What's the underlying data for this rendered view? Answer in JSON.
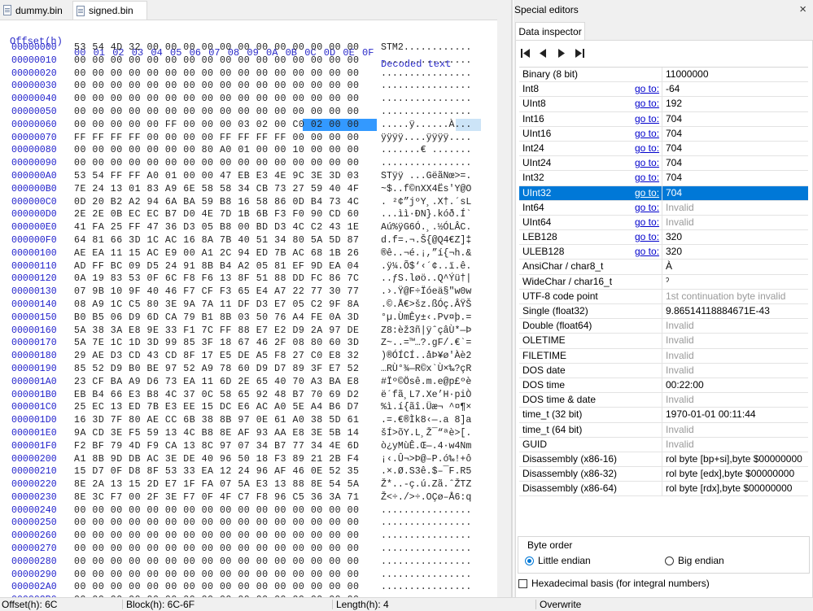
{
  "tabs": [
    {
      "label": "dummy.bin",
      "active": false
    },
    {
      "label": "signed.bin",
      "active": true
    }
  ],
  "hex_header": {
    "offset_label": "Offset(h)",
    "columns": [
      "00",
      "01",
      "02",
      "03",
      "04",
      "05",
      "06",
      "07",
      "08",
      "09",
      "0A",
      "0B",
      "0C",
      "0D",
      "0E",
      "0F"
    ],
    "decoded_label": "Decoded text"
  },
  "hex_rows": [
    {
      "offset": "00000000",
      "bytes": "53 54 4D 32 00 00 00 00 00 00 00 00 00 00 00 00",
      "text": "STM2............"
    },
    {
      "offset": "00000010",
      "bytes": "00 00 00 00 00 00 00 00 00 00 00 00 00 00 00 00",
      "text": "................"
    },
    {
      "offset": "00000020",
      "bytes": "00 00 00 00 00 00 00 00 00 00 00 00 00 00 00 00",
      "text": "................"
    },
    {
      "offset": "00000030",
      "bytes": "00 00 00 00 00 00 00 00 00 00 00 00 00 00 00 00",
      "text": "................"
    },
    {
      "offset": "00000040",
      "bytes": "00 00 00 00 00 00 00 00 00 00 00 00 00 00 00 00",
      "text": "................"
    },
    {
      "offset": "00000050",
      "bytes": "00 00 00 00 00 00 00 00 00 00 00 00 00 00 00 00",
      "text": "................"
    },
    {
      "offset": "00000060",
      "bytes": "00 00 00 00 00 FF 00 00 00 03 02 00 C0 02 00 00",
      "text": ".....ÿ......À..."
    },
    {
      "offset": "00000070",
      "bytes": "FF FF FF FF 00 00 00 00 FF FF FF FF 00 00 00 00",
      "text": "ÿÿÿÿ....ÿÿÿÿ...."
    },
    {
      "offset": "00000080",
      "bytes": "00 00 00 00 00 00 00 80 A0 01 00 00 10 00 00 00",
      "text": ".......€ ......."
    },
    {
      "offset": "00000090",
      "bytes": "00 00 00 00 00 00 00 00 00 00 00 00 00 00 00 00",
      "text": "................"
    },
    {
      "offset": "000000A0",
      "bytes": "53 54 FF FF A0 01 00 00 47 EB E3 4E 9C 3E 3D 03",
      "text": "STÿÿ ...GëãNœ>=."
    },
    {
      "offset": "000000B0",
      "bytes": "7E 24 13 01 83 A9 6E 58 58 34 CB 73 27 59 40 4F",
      "text": "~$..f©nXX4Ës'Y@O"
    },
    {
      "offset": "000000C0",
      "bytes": "0D 20 B2 A2 94 6A BA 59 B8 16 58 86 0D B4 73 4C",
      "text": ". ²¢”jºY¸.X†.´sL"
    },
    {
      "offset": "000000D0",
      "bytes": "2E 2E 0B EC EC B7 D0 4E 7D 1B 6B F3 F0 90 CD 60",
      "text": "...ìì·ÐN}.kóð.Í`"
    },
    {
      "offset": "000000E0",
      "bytes": "41 FA 25 FF 47 36 D3 05 B8 00 BD D3 4C C2 43 1E",
      "text": "Aú%ÿG6Ó.¸.½ÓLÂC."
    },
    {
      "offset": "000000F0",
      "bytes": "64 81 66 3D 1C AC 16 8A 7B 40 51 34 80 5A 5D 87",
      "text": "d.f=.¬.Š{@Q4€Z]‡"
    },
    {
      "offset": "00000100",
      "bytes": "AE EA 11 15 AC E9 00 A1 2C 94 ED 7B AC 68 1B 26",
      "text": "®ê..¬é.¡,”í{¬h.&"
    },
    {
      "offset": "00000110",
      "bytes": "AD FF BC 09 D5 24 91 8B B4 A2 05 81 EF 9D EA 04",
      "text": ".ÿ¼.Õ$‘‹´¢..ï.ê."
    },
    {
      "offset": "00000120",
      "bytes": "0A 19 83 53 0F 6C F8 F6 13 8F 51 88 DD FC 86 7C",
      "text": "..ƒS.løö..Q^Ýü†|"
    },
    {
      "offset": "00000130",
      "bytes": "07 9B 10 9F 40 46 F7 CF F3 65 E4 A7 22 77 30 77",
      "text": ".›.Ÿ@F÷Ïóeä§\"w0w"
    },
    {
      "offset": "00000140",
      "bytes": "08 A9 1C C5 80 3E 9A 7A 11 DF D3 E7 05 C2 9F 8A",
      "text": ".©.Å€>šz.ßÓç.ÂŸŠ"
    },
    {
      "offset": "00000150",
      "bytes": "B0 B5 06 D9 6D CA 79 B1 8B 03 50 76 A4 FE 0A 3D",
      "text": "°µ.ÙmÊy±‹.Pv¤þ.="
    },
    {
      "offset": "00000160",
      "bytes": "5A 38 3A E8 9E 33 F1 7C FF 88 E7 E2 D9 2A 97 DE",
      "text": "Z8:èž3ñ|ÿˆçâÙ*—Þ"
    },
    {
      "offset": "00000170",
      "bytes": "5A 7E 1C 1D 3D 99 85 3F 18 67 46 2F 08 80 60 3D",
      "text": "Z~..=™…?.gF/.€`="
    },
    {
      "offset": "00000180",
      "bytes": "29 AE D3 CD 43 CD 8F 17 E5 DE A5 F8 27 C0 E8 32",
      "text": ")®ÓÍCÍ..åÞ¥ø'Àè2"
    },
    {
      "offset": "00000190",
      "bytes": "85 52 D9 B0 BE 97 52 A9 78 60 D9 D7 89 3F E7 52",
      "text": "…RÙ°¾—R©x`Ù×‰?çR"
    },
    {
      "offset": "000001A0",
      "bytes": "23 CF BA A9 D6 73 EA 11 6D 2E 65 40 70 A3 BA E8",
      "text": "#Ïº©Ösê.m.e@p£ºè"
    },
    {
      "offset": "000001B0",
      "bytes": "EB B4 66 E3 B8 4C 37 0C 58 65 92 48 B7 70 69 D2",
      "text": "ë´fã¸L7.Xe’H·piÒ"
    },
    {
      "offset": "000001C0",
      "bytes": "25 EC 13 ED 7B E3 EE 15 DC E6 AC A0 5E A4 B6 D7",
      "text": "%ì.í{ãî.Üæ¬ ^¤¶×"
    },
    {
      "offset": "000001D0",
      "bytes": "16 3D 7F 80 AE CC 6B 38 8B 97 0E 61 A0 38 5D 61",
      "text": ".=.€®Ìk8‹—.a 8]a"
    },
    {
      "offset": "000001E0",
      "bytes": "9A CD 3E F5 59 13 4C B8 8E AF 93 AA E8 3E 5B 14",
      "text": "šÍ>õY.L¸Ž¯“ªè>[."
    },
    {
      "offset": "000001F0",
      "bytes": "F2 BF 79 4D F9 CA 13 8C 97 07 34 B7 77 34 4E 6D",
      "text": "ò¿yMùÊ.Œ—.4·w4Nm"
    },
    {
      "offset": "00000200",
      "bytes": "A1 8B 9D DB AC 3E DE 40 96 50 18 F3 89 21 2B F4",
      "text": "¡‹.Û¬>Þ@–P.ó‰!+ô"
    },
    {
      "offset": "00000210",
      "bytes": "15 D7 0F D8 8F 53 33 EA 12 24 96 AF 46 0E 52 35",
      "text": ".×.Ø.S3ê.$–¯F.R5"
    },
    {
      "offset": "00000220",
      "bytes": "8E 2A 13 15 2D E7 1F FA 07 5A E3 13 88 8E 54 5A",
      "text": "Ž*..-ç.ú.Zã.ˆŽTZ"
    },
    {
      "offset": "00000230",
      "bytes": "8E 3C F7 00 2F 3E F7 0F 4F C7 F8 96 C5 36 3A 71",
      "text": "Ž<÷./>÷.OÇø–Å6:q"
    },
    {
      "offset": "00000240",
      "bytes": "00 00 00 00 00 00 00 00 00 00 00 00 00 00 00 00",
      "text": "................"
    },
    {
      "offset": "00000250",
      "bytes": "00 00 00 00 00 00 00 00 00 00 00 00 00 00 00 00",
      "text": "................"
    },
    {
      "offset": "00000260",
      "bytes": "00 00 00 00 00 00 00 00 00 00 00 00 00 00 00 00",
      "text": "................"
    },
    {
      "offset": "00000270",
      "bytes": "00 00 00 00 00 00 00 00 00 00 00 00 00 00 00 00",
      "text": "................"
    },
    {
      "offset": "00000280",
      "bytes": "00 00 00 00 00 00 00 00 00 00 00 00 00 00 00 00",
      "text": "................"
    },
    {
      "offset": "00000290",
      "bytes": "00 00 00 00 00 00 00 00 00 00 00 00 00 00 00 00",
      "text": "................"
    },
    {
      "offset": "000002A0",
      "bytes": "00 00 00 00 00 00 00 00 00 00 00 00 00 00 00 00",
      "text": "................"
    },
    {
      "offset": "000002B0",
      "bytes": "00 00 00 00 00 00 00 00 00 00 00 00 00 00 00 00",
      "text": "................"
    }
  ],
  "special_editors": {
    "title": "Special editors",
    "close_glyph": "×",
    "tab_label": "Data inspector",
    "go_to_label": "go to:",
    "rows": [
      {
        "name": "Binary (8 bit)",
        "goto": false,
        "value": "11000000",
        "invalid": false,
        "selected": false
      },
      {
        "name": "Int8",
        "goto": true,
        "value": "-64",
        "invalid": false,
        "selected": false
      },
      {
        "name": "UInt8",
        "goto": true,
        "value": "192",
        "invalid": false,
        "selected": false
      },
      {
        "name": "Int16",
        "goto": true,
        "value": "704",
        "invalid": false,
        "selected": false
      },
      {
        "name": "UInt16",
        "goto": true,
        "value": "704",
        "invalid": false,
        "selected": false
      },
      {
        "name": "Int24",
        "goto": true,
        "value": "704",
        "invalid": false,
        "selected": false
      },
      {
        "name": "UInt24",
        "goto": true,
        "value": "704",
        "invalid": false,
        "selected": false
      },
      {
        "name": "Int32",
        "goto": true,
        "value": "704",
        "invalid": false,
        "selected": false
      },
      {
        "name": "UInt32",
        "goto": true,
        "value": "704",
        "invalid": false,
        "selected": true
      },
      {
        "name": "Int64",
        "goto": true,
        "value": "Invalid",
        "invalid": true,
        "selected": false
      },
      {
        "name": "UInt64",
        "goto": true,
        "value": "Invalid",
        "invalid": true,
        "selected": false
      },
      {
        "name": "LEB128",
        "goto": true,
        "value": "320",
        "invalid": false,
        "selected": false
      },
      {
        "name": "ULEB128",
        "goto": true,
        "value": "320",
        "invalid": false,
        "selected": false
      },
      {
        "name": "AnsiChar / char8_t",
        "goto": false,
        "value": "À",
        "invalid": false,
        "selected": false
      },
      {
        "name": "WideChar / char16_t",
        "goto": false,
        "value": "ˀ",
        "invalid": false,
        "selected": false
      },
      {
        "name": "UTF-8 code point",
        "goto": false,
        "value": "1st continuation byte invalid",
        "invalid": true,
        "selected": false
      },
      {
        "name": "Single (float32)",
        "goto": false,
        "value": "9.86514118884671E-43",
        "invalid": false,
        "selected": false
      },
      {
        "name": "Double (float64)",
        "goto": false,
        "value": "Invalid",
        "invalid": true,
        "selected": false
      },
      {
        "name": "OLETIME",
        "goto": false,
        "value": "Invalid",
        "invalid": true,
        "selected": false
      },
      {
        "name": "FILETIME",
        "goto": false,
        "value": "Invalid",
        "invalid": true,
        "selected": false
      },
      {
        "name": "DOS date",
        "goto": false,
        "value": "Invalid",
        "invalid": true,
        "selected": false
      },
      {
        "name": "DOS time",
        "goto": false,
        "value": "00:22:00",
        "invalid": false,
        "selected": false
      },
      {
        "name": "DOS time & date",
        "goto": false,
        "value": "Invalid",
        "invalid": true,
        "selected": false
      },
      {
        "name": "time_t (32 bit)",
        "goto": false,
        "value": "1970-01-01 00:11:44",
        "invalid": false,
        "selected": false
      },
      {
        "name": "time_t (64 bit)",
        "goto": false,
        "value": "Invalid",
        "invalid": true,
        "selected": false
      },
      {
        "name": "GUID",
        "goto": false,
        "value": "Invalid",
        "invalid": true,
        "selected": false
      },
      {
        "name": "Disassembly (x86-16)",
        "goto": false,
        "value": "rol byte [bp+si],byte $00000000",
        "invalid": false,
        "selected": false
      },
      {
        "name": "Disassembly (x86-32)",
        "goto": false,
        "value": "rol byte [edx],byte $00000000",
        "invalid": false,
        "selected": false
      },
      {
        "name": "Disassembly (x86-64)",
        "goto": false,
        "value": "rol byte [rdx],byte $00000000",
        "invalid": false,
        "selected": false
      }
    ],
    "byte_order": {
      "legend": "Byte order",
      "little_endian": "Little endian",
      "big_endian": "Big endian",
      "selected": "little"
    },
    "hex_basis_label": "Hexadecimal basis (for integral numbers)",
    "hex_basis_checked": false
  },
  "statusbar": {
    "offset": "Offset(h): 6C",
    "block": "Block(h): 6C-6F",
    "length": "Length(h): 4",
    "mode": "Overwrite"
  },
  "colors": {
    "offset_blue": "#2222cc",
    "selection_blue": "#3399ff",
    "row_highlight": "#0078d7",
    "invalid_gray": "#9a9a9a"
  }
}
